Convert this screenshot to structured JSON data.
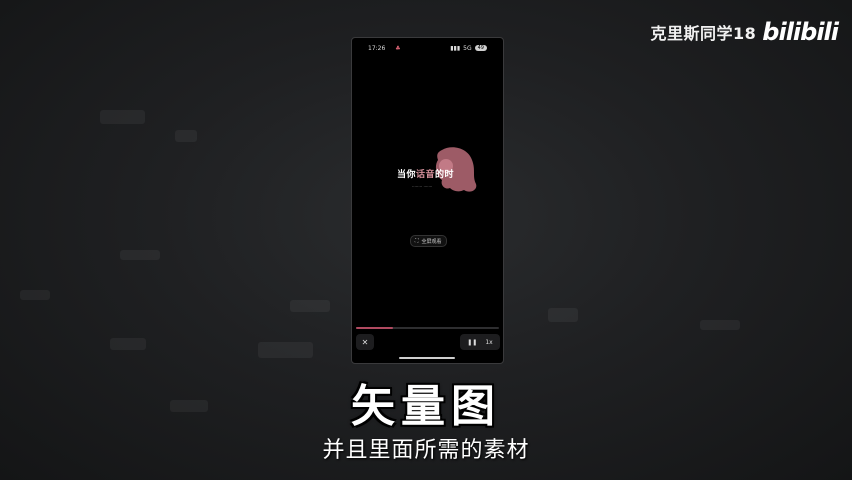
{
  "watermark": {
    "channel": "克里斯同学18",
    "logo_text": "bilibili"
  },
  "phone": {
    "status": {
      "time": "17:26",
      "signal": "5G",
      "battery": "49"
    },
    "hero": {
      "part1": "当你",
      "part2": "话音",
      "part3": "的时"
    },
    "pill_label": "全屏观看",
    "progress": 0.26,
    "close_icon": "✕",
    "pause_icon": "❚❚",
    "speed": "1x"
  },
  "subtitle": {
    "main": "矢量图",
    "secondary": "并且里面所需的素材"
  },
  "colors": {
    "accent_pink": "#d48f9a",
    "progress": "#b04a60"
  }
}
